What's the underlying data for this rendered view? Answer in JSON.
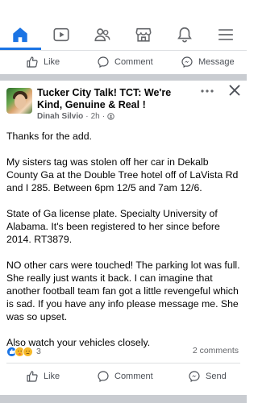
{
  "nav": {
    "items": [
      {
        "name": "home",
        "active": true
      },
      {
        "name": "video"
      },
      {
        "name": "friends"
      },
      {
        "name": "marketplace"
      },
      {
        "name": "notifications"
      },
      {
        "name": "menu"
      }
    ],
    "accent": "#1b74e4"
  },
  "prev_post_actions": {
    "like": "Like",
    "comment": "Comment",
    "message": "Message"
  },
  "post": {
    "group_name": "Tucker City Talk! TCT: We're Kind, Genuine & Real !",
    "author": "Dinah Silvio",
    "time": "2h",
    "dot": "·",
    "paragraphs": [
      "Thanks for the add.",
      "My sisters tag was stolen off her car in Dekalb County Ga at the Double Tree hotel off of LaVista Rd and I 285. Between 6pm 12/5 and 7am 12/6.",
      "State of Ga license plate. Specialty University of Alabama. It's been registered to her since before 2014. RT3879.",
      "NO other cars were touched! The parking lot was full. She really just wants it back. I can imagine that another football team fan got a little revengeful which is sad. If you have any info please message me. She was so upset.",
      "Also watch your vehicles closely."
    ],
    "reaction_count": "3",
    "comments_count": "2 comments",
    "actions": {
      "like": "Like",
      "comment": "Comment",
      "send": "Send"
    }
  }
}
